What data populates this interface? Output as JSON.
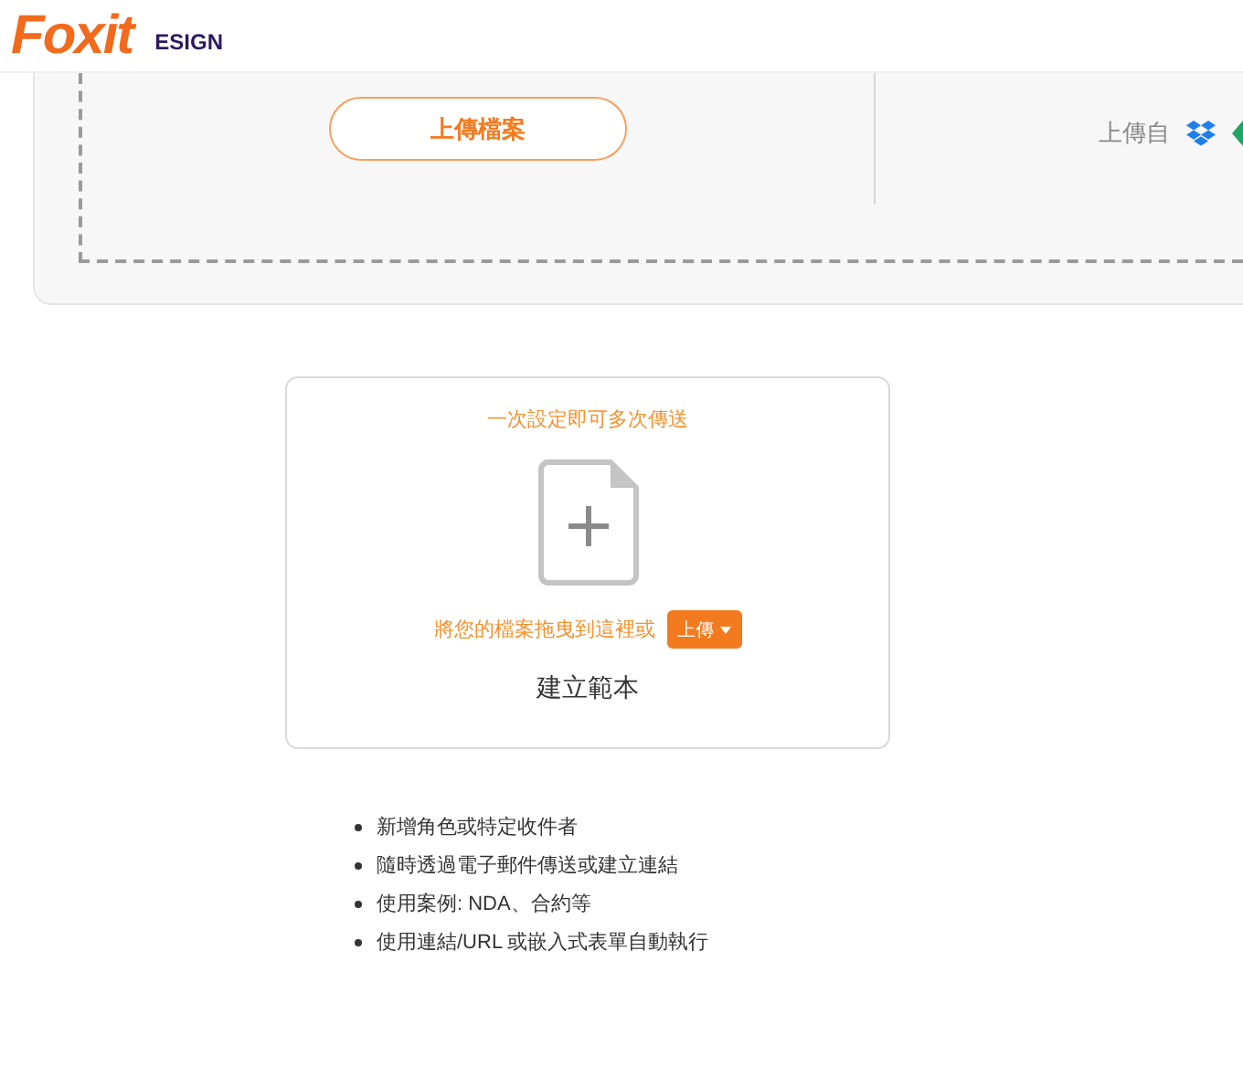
{
  "logo": {
    "brand": "Foxit",
    "product": "ESIGN"
  },
  "upload_panel": {
    "button": "上傳檔案",
    "source_label": "上傳自"
  },
  "template_card": {
    "tagline": "一次設定即可多次傳送",
    "drop_hint": "將您的檔案拖曳到這裡或",
    "upload_button": "上傳",
    "title": "建立範本"
  },
  "features": [
    "新增角色或特定收件者",
    "隨時透過電子郵件傳送或建立連結",
    "使用案例: NDA、合約等",
    "使用連結/URL 或嵌入式表單自動執行"
  ]
}
